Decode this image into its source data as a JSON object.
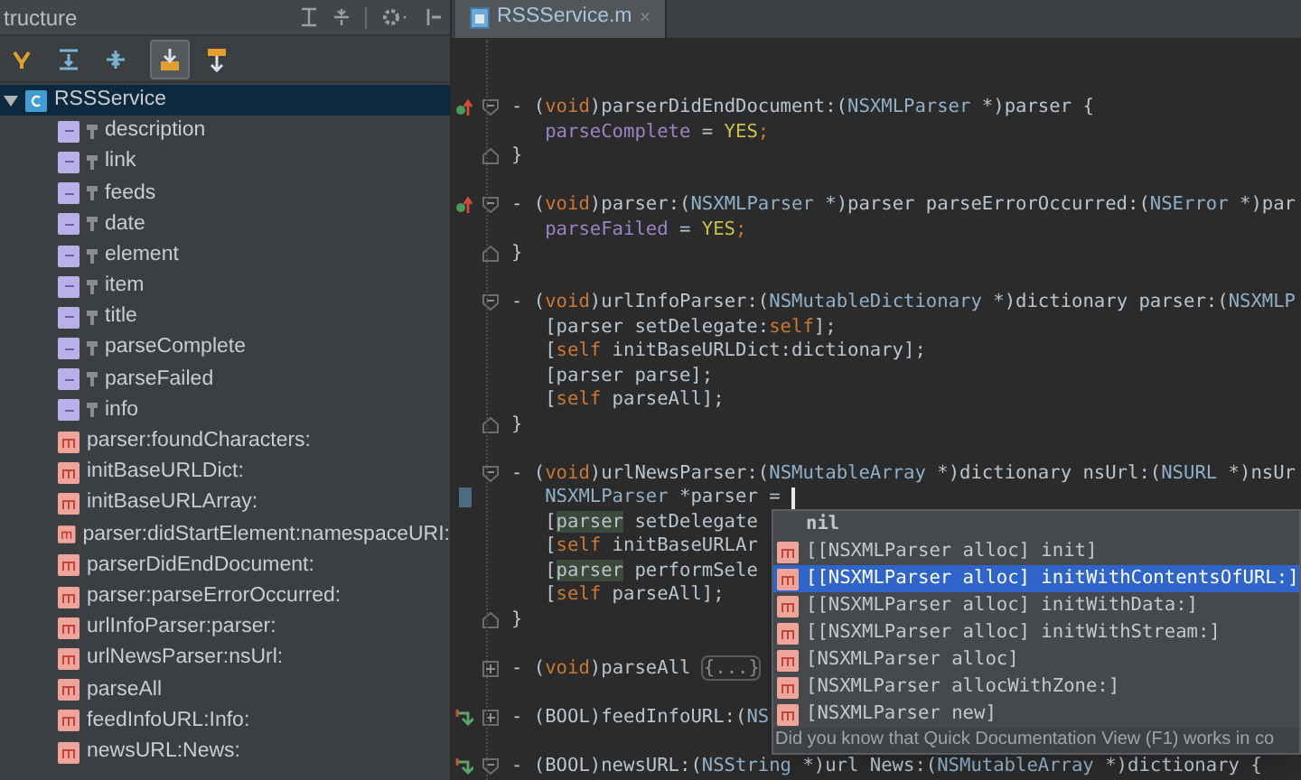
{
  "structure": {
    "title": "tructure",
    "toolbar": [
      {
        "selected": false
      },
      {
        "selected": false
      },
      {
        "selected": false
      },
      {
        "selected": true
      },
      {
        "selected": false
      }
    ],
    "tree": [
      {
        "label": "RSSService",
        "kind": "class",
        "expanded": true,
        "selected": true,
        "children": [
          {
            "label": "description",
            "kind": "field",
            "selected": false
          },
          {
            "label": "link",
            "kind": "field",
            "selected": false
          },
          {
            "label": "feeds",
            "kind": "field",
            "selected": false
          },
          {
            "label": "date",
            "kind": "field",
            "selected": false
          },
          {
            "label": "element",
            "kind": "field",
            "selected": false
          },
          {
            "label": "item",
            "kind": "field",
            "selected": false
          },
          {
            "label": "title",
            "kind": "field",
            "selected": false
          },
          {
            "label": "parseComplete",
            "kind": "field",
            "selected": false
          },
          {
            "label": "parseFailed",
            "kind": "field",
            "selected": false
          },
          {
            "label": "info",
            "kind": "field",
            "selected": false
          },
          {
            "label": "parser:foundCharacters:",
            "kind": "method",
            "selected": false
          },
          {
            "label": "initBaseURLDict:",
            "kind": "method",
            "selected": false
          },
          {
            "label": "initBaseURLArray:",
            "kind": "method",
            "selected": false
          },
          {
            "label": "parser:didStartElement:namespaceURI:",
            "kind": "method",
            "selected": false
          },
          {
            "label": "parserDidEndDocument:",
            "kind": "method",
            "selected": false
          },
          {
            "label": "parser:parseErrorOccurred:",
            "kind": "method",
            "selected": false
          },
          {
            "label": "urlInfoParser:parser:",
            "kind": "method",
            "selected": false
          },
          {
            "label": "urlNewsParser:nsUrl:",
            "kind": "method",
            "selected": false
          },
          {
            "label": "parseAll",
            "kind": "method",
            "selected": false
          },
          {
            "label": "feedInfoURL:Info:",
            "kind": "method",
            "selected": false
          },
          {
            "label": "newsURL:News:",
            "kind": "method",
            "selected": false
          }
        ]
      }
    ]
  },
  "editor": {
    "tabs": [
      {
        "label": "RSSService.m",
        "close": "×",
        "selected": true
      }
    ],
    "lines": [
      {
        "fold": {
          "kind": "start"
        },
        "marker": {
          "kind": "override"
        },
        "segments": [
          {
            "kind": "plain",
            "text": "- ("
          },
          {
            "kind": "keyword",
            "text": "void"
          },
          {
            "kind": "plain",
            "text": ")parserDidEndDocument:("
          },
          {
            "kind": "type",
            "text": "NSXMLParser"
          },
          {
            "kind": "plain",
            "text": " *)parser {"
          }
        ]
      },
      {
        "indent": true,
        "segments": [
          {
            "kind": "field",
            "text": "parseComplete"
          },
          {
            "kind": "plain",
            "text": " = "
          },
          {
            "kind": "literal",
            "text": "YES"
          },
          {
            "kind": "keyword",
            "text": ";"
          }
        ]
      },
      {
        "fold": {
          "kind": "end"
        },
        "segments": [
          {
            "kind": "plain",
            "text": "}"
          }
        ]
      },
      {
        "space_before": true,
        "fold": {
          "kind": "start"
        },
        "marker": {
          "kind": "override"
        },
        "segments": [
          {
            "kind": "plain",
            "text": "- ("
          },
          {
            "kind": "keyword",
            "text": "void"
          },
          {
            "kind": "plain",
            "text": ")parser:("
          },
          {
            "kind": "type",
            "text": "NSXMLParser"
          },
          {
            "kind": "plain",
            "text": " *)parser parseErrorOccurred:("
          },
          {
            "kind": "type",
            "text": "NSError"
          },
          {
            "kind": "plain",
            "text": " *)par"
          }
        ]
      },
      {
        "indent": true,
        "segments": [
          {
            "kind": "field",
            "text": "parseFailed"
          },
          {
            "kind": "plain",
            "text": " = "
          },
          {
            "kind": "literal",
            "text": "YES"
          },
          {
            "kind": "keyword",
            "text": ";"
          }
        ]
      },
      {
        "fold": {
          "kind": "end"
        },
        "segments": [
          {
            "kind": "plain",
            "text": "}"
          }
        ]
      },
      {
        "space_before": true,
        "fold": {
          "kind": "start"
        },
        "segments": [
          {
            "kind": "plain",
            "text": "- ("
          },
          {
            "kind": "keyword",
            "text": "void"
          },
          {
            "kind": "plain",
            "text": ")urlInfoParser:("
          },
          {
            "kind": "type",
            "text": "NSMutableDictionary"
          },
          {
            "kind": "plain",
            "text": " *)dictionary parser:("
          },
          {
            "kind": "type",
            "text": "NSXMLP"
          }
        ]
      },
      {
        "indent": true,
        "segments": [
          {
            "kind": "plain",
            "text": "[parser setDelegate:"
          },
          {
            "kind": "keyword",
            "text": "self"
          },
          {
            "kind": "plain",
            "text": "];"
          }
        ]
      },
      {
        "indent": true,
        "segments": [
          {
            "kind": "plain",
            "text": "["
          },
          {
            "kind": "keyword",
            "text": "self"
          },
          {
            "kind": "plain",
            "text": " initBaseURLDict:dictionary];"
          }
        ]
      },
      {
        "indent": true,
        "segments": [
          {
            "kind": "plain",
            "text": "[parser parse];"
          }
        ]
      },
      {
        "indent": true,
        "segments": [
          {
            "kind": "plain",
            "text": "["
          },
          {
            "kind": "keyword",
            "text": "self"
          },
          {
            "kind": "plain",
            "text": " parseAll];"
          }
        ]
      },
      {
        "fold": {
          "kind": "end"
        },
        "segments": [
          {
            "kind": "plain",
            "text": "}"
          }
        ]
      },
      {
        "space_before": true,
        "fold": {
          "kind": "start"
        },
        "segments": [
          {
            "kind": "plain",
            "text": "- ("
          },
          {
            "kind": "keyword",
            "text": "void"
          },
          {
            "kind": "plain",
            "text": ")urlNewsParser:("
          },
          {
            "kind": "type",
            "text": "NSMutableArray"
          },
          {
            "kind": "plain",
            "text": " *)dictionary nsUrl:("
          },
          {
            "kind": "type",
            "text": "NSURL"
          },
          {
            "kind": "plain",
            "text": " *)nsUr"
          }
        ]
      },
      {
        "indent": true,
        "marker": {
          "kind": "current"
        },
        "caret": true,
        "segments": [
          {
            "kind": "type",
            "text": "NSXMLParser"
          },
          {
            "kind": "plain",
            "text": " *parser = "
          }
        ]
      },
      {
        "indent": true,
        "segments": [
          {
            "kind": "plain",
            "text": "["
          },
          {
            "kind": "usage",
            "text": "parser"
          },
          {
            "kind": "plain",
            "text": " setDelegate"
          }
        ]
      },
      {
        "indent": true,
        "segments": [
          {
            "kind": "plain",
            "text": "["
          },
          {
            "kind": "keyword",
            "text": "self"
          },
          {
            "kind": "plain",
            "text": " initBaseURLAr"
          }
        ]
      },
      {
        "indent": true,
        "segments": [
          {
            "kind": "plain",
            "text": "["
          },
          {
            "kind": "usage",
            "text": "parser"
          },
          {
            "kind": "plain",
            "text": " performSele"
          }
        ]
      },
      {
        "indent": true,
        "segments": [
          {
            "kind": "plain",
            "text": "["
          },
          {
            "kind": "keyword",
            "text": "self"
          },
          {
            "kind": "plain",
            "text": " parseAll];"
          }
        ]
      },
      {
        "fold": {
          "kind": "end"
        },
        "segments": [
          {
            "kind": "plain",
            "text": "}"
          }
        ]
      },
      {
        "space_before": true,
        "fold": {
          "kind": "collapsed"
        },
        "segments": [
          {
            "kind": "plain",
            "text": "- ("
          },
          {
            "kind": "keyword",
            "text": "void"
          },
          {
            "kind": "plain",
            "text": ")parseAll "
          },
          {
            "kind": "folded",
            "text": "{...}"
          }
        ]
      },
      {
        "space_before": true,
        "fold": {
          "kind": "collapsed"
        },
        "marker": {
          "kind": "implements"
        },
        "segments": [
          {
            "kind": "plain",
            "text": "- (BOOL)feedInfoURL:("
          },
          {
            "kind": "type",
            "text": "NS"
          }
        ]
      },
      {
        "space_before": true,
        "fold": {
          "kind": "start"
        },
        "marker": {
          "kind": "implements"
        },
        "segments": [
          {
            "kind": "plain",
            "text": "- (BOOL)newsURL:("
          },
          {
            "kind": "type",
            "text": "NSString"
          },
          {
            "kind": "plain",
            "text": " *)url News:("
          },
          {
            "kind": "type",
            "text": "NSMutableArray"
          },
          {
            "kind": "plain",
            "text": " *)dictionary {"
          }
        ]
      }
    ],
    "completion": {
      "items": [
        {
          "label": "nil",
          "kind": "keyword",
          "selected": false
        },
        {
          "label": "[[NSXMLParser alloc] init]",
          "kind": "method",
          "selected": false
        },
        {
          "label": "[[NSXMLParser alloc] initWithContentsOfURL:]",
          "kind": "method",
          "selected": true
        },
        {
          "label": "[[NSXMLParser alloc] initWithData:]",
          "kind": "method",
          "selected": false
        },
        {
          "label": "[[NSXMLParser alloc] initWithStream:]",
          "kind": "method",
          "selected": false
        },
        {
          "label": "[NSXMLParser alloc]",
          "kind": "method",
          "selected": false
        },
        {
          "label": "[NSXMLParser allocWithZone:]",
          "kind": "method",
          "selected": false
        },
        {
          "label": "[NSXMLParser new]",
          "kind": "method",
          "selected": false
        }
      ],
      "hint": "Did you know that Quick Documentation View (F1) works in co"
    }
  }
}
